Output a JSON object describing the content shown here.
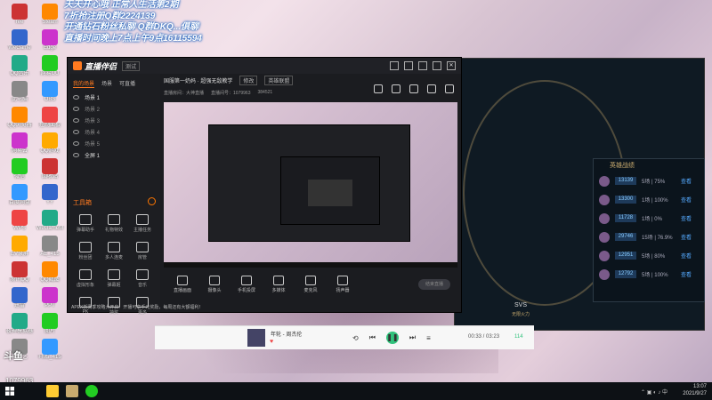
{
  "overlay": {
    "line1": "天天开心哦  正常人生活第2期",
    "line2": "7折抢注册Q群2224139",
    "line3": "开通钻石粉丝私聊  Q群DKQ...俱聊",
    "line4": "直播时间晚上7点上午9点16115594"
  },
  "desktop_icons": [
    "ree",
    "WeGame",
    "QQ音乐",
    "此电脑",
    "QQ浏览器",
    "网易云",
    "微信",
    "百度网盘",
    "WPS",
    "EV录屏",
    "腾讯QQ",
    "迅雷",
    "夜神模拟器",
    "爱奇艺",
    "Steam",
    "Edge",
    "网易UU",
    "OBS",
    "控制面板",
    "QQ游戏",
    "回收站",
    "YY",
    "WeGameM",
    "AE_415",
    "QQ截图",
    "PPT",
    "图片",
    "FM5_415"
  ],
  "app": {
    "logo": "直播伴侣",
    "version": "测试",
    "tabs": [
      "我的场景",
      "场景",
      "可直播"
    ],
    "scenes": [
      "场景 1",
      "场景 2",
      "场景 3",
      "场景 4",
      "场景 5",
      "全屏 1"
    ],
    "toolbox_title": "工具箱",
    "tools": [
      "弹幕助手",
      "礼物特效",
      "主播任务",
      "粉丝团",
      "多人连麦",
      "房管",
      "虚拟形象",
      "弹幕姬",
      "音乐",
      "PK",
      "抽奖",
      "更多"
    ],
    "stream_title": "国服第一奶妈 · 超强无敌教学",
    "edit_chip": "修改",
    "category_chip": "英雄联盟",
    "meta_room": "直播房间：大神直播",
    "meta_uid": "直播间号：1079963",
    "meta_fans": "粉丝",
    "meta_count": "384521",
    "controls": [
      "直播画面",
      "摄像头",
      "手机投屏",
      "多媒体",
      "麦克风",
      "扬声器"
    ],
    "go_live": "结束直播",
    "status": "APEX新赛季攻略大开启！开播可享千元奖励，每周还有大额福利！"
  },
  "rank_panel": {
    "title": "英雄战绩",
    "rows": [
      {
        "score": "13139",
        "record": "5场 | 75%",
        "link": "查看"
      },
      {
        "score": "13300",
        "record": "1场 | 100%",
        "link": "查看"
      },
      {
        "score": "11728",
        "record": "1场 | 0%",
        "link": "查看"
      },
      {
        "score": "29746",
        "record": "15场 | 76.9%",
        "link": "查看"
      },
      {
        "score": "12951",
        "record": "5场 | 80%",
        "link": "查看"
      },
      {
        "score": "12792",
        "record": "5场 | 100%",
        "link": "查看"
      }
    ]
  },
  "game": {
    "timer": "SVS",
    "sub": "无限火力"
  },
  "music": {
    "song": "年轮 - 周杰伦",
    "time": "00:33 / 03:23",
    "count": "114"
  },
  "watermark": {
    "brand": "斗鱼",
    "id": "1079963"
  },
  "taskbar": {
    "time": "13:07",
    "date": "2021/9/27"
  }
}
